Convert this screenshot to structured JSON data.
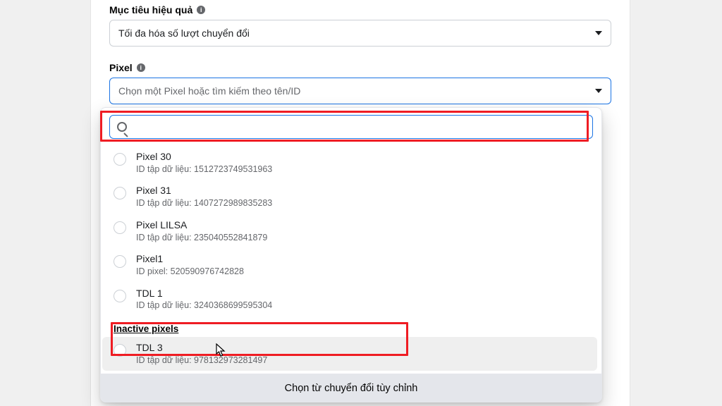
{
  "performance_goal": {
    "label": "Mục tiêu hiệu quả",
    "value": "Tối đa hóa số lượt chuyển đổi"
  },
  "pixel_field": {
    "label": "Pixel",
    "placeholder": "Chọn một Pixel hoặc tìm kiếm theo tên/ID"
  },
  "search": {
    "value": ""
  },
  "inactive_group_label": "Inactive pixels",
  "footer_button": "Chọn từ chuyển đổi tùy chỉnh",
  "options": [
    {
      "title": "Pixel 30",
      "sub_prefix": "ID tập dữ liệu: ",
      "id": "1512723749531963"
    },
    {
      "title": "Pixel 31",
      "sub_prefix": "ID tập dữ liệu: ",
      "id": "1407272989835283"
    },
    {
      "title": "Pixel LILSA",
      "sub_prefix": "ID tập dữ liệu: ",
      "id": "235040552841879"
    },
    {
      "title": "Pixel1",
      "sub_prefix": "ID pixel: ",
      "id": "520590976742828"
    },
    {
      "title": "TDL 1",
      "sub_prefix": "ID tập dữ liệu: ",
      "id": "3240368699595304"
    }
  ],
  "inactive_options": [
    {
      "title": "TDL 3",
      "sub_prefix": "ID tập dữ liệu: ",
      "id": "978132973281497"
    }
  ]
}
